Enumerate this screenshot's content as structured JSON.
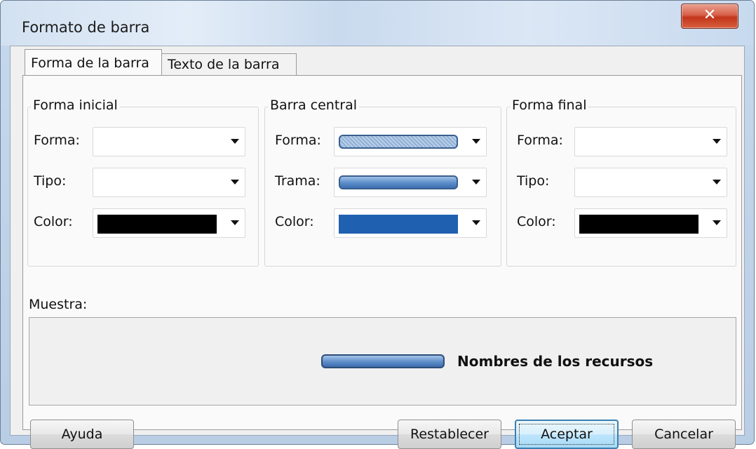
{
  "window": {
    "title": "Formato de barra",
    "close_icon": "close-icon"
  },
  "tabs": [
    {
      "label": "Forma de la barra",
      "selected": true
    },
    {
      "label": "Texto de la barra",
      "selected": false
    }
  ],
  "groups": {
    "start": {
      "legend": "Forma inicial",
      "shape_label": "Forma:",
      "type_label": "Tipo:",
      "color_label": "Color:",
      "color_value": "#000000"
    },
    "middle": {
      "legend": "Barra central",
      "shape_label": "Forma:",
      "pattern_label": "Trama:",
      "color_label": "Color:",
      "color_value": "#2060b0"
    },
    "end": {
      "legend": "Forma final",
      "shape_label": "Forma:",
      "type_label": "Tipo:",
      "color_label": "Color:",
      "color_value": "#000000"
    }
  },
  "sample": {
    "label": "Muestra:",
    "text": "Nombres de los recursos"
  },
  "buttons": {
    "help": "Ayuda",
    "reset": "Restablecer",
    "ok": "Aceptar",
    "cancel": "Cancelar"
  }
}
